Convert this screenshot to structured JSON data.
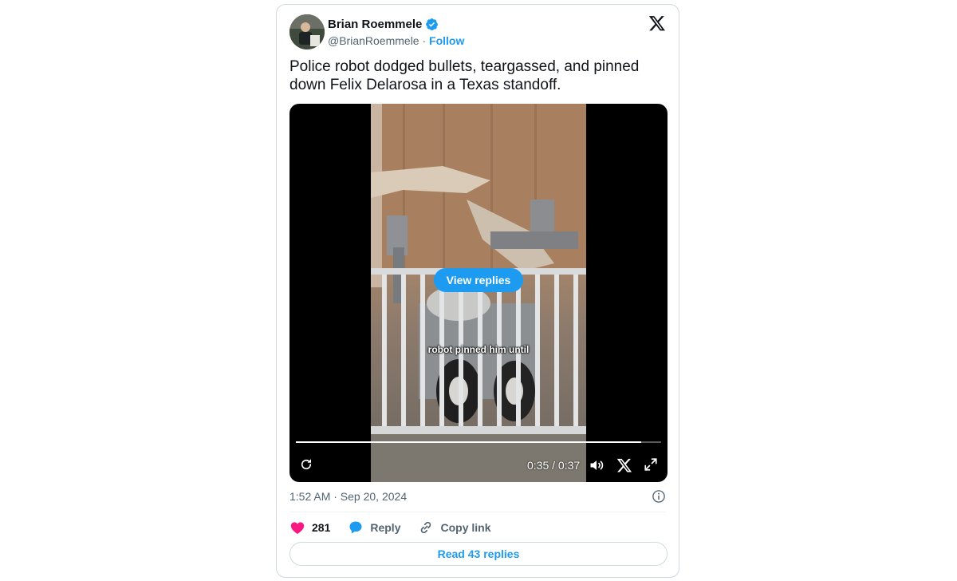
{
  "author": {
    "name": "Brian Roemmele",
    "handle": "@BrianRoemmele",
    "separator": " · ",
    "follow_label": "Follow"
  },
  "tweet": {
    "text": "Police robot dodged bullets, teargassed, and pinned down Felix Delarosa in a Texas standoff.",
    "timestamp": "1:52 AM · Sep 20, 2024"
  },
  "video": {
    "caption": "robot pinned him until",
    "view_replies_label": "View replies",
    "time": "0:35 / 0:37",
    "progress": 0.946
  },
  "actions": {
    "likes": "281",
    "reply_label": "Reply",
    "copy_link_label": "Copy link"
  },
  "read_replies_label": "Read 43 replies",
  "colors": {
    "accent": "#1d9bf0",
    "like": "#f91880",
    "text": "#0f1419",
    "muted": "#536471"
  }
}
